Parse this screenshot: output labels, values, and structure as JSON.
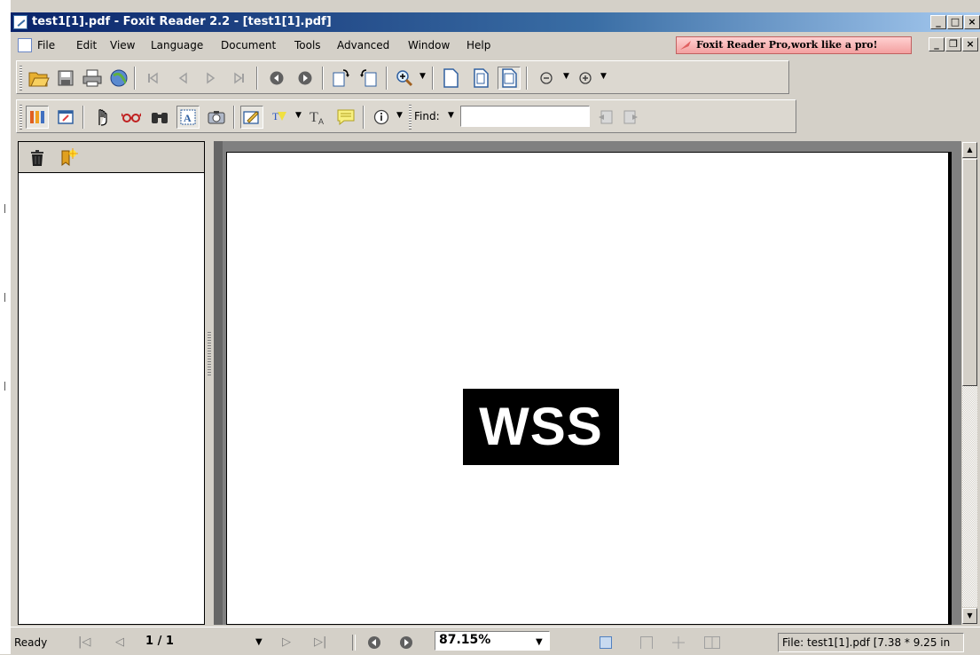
{
  "window": {
    "title": "test1[1].pdf - Foxit Reader 2.2 - [test1[1].pdf]",
    "controls": {
      "minimize": "_",
      "maximize": "□",
      "close": "×"
    }
  },
  "menu": {
    "items": [
      "File",
      "Edit",
      "View",
      "Language",
      "Document",
      "Tools",
      "Advanced",
      "Window",
      "Help"
    ],
    "ad_text": "Foxit Reader Pro,work like a pro!",
    "mdi_controls": {
      "minimize": "_",
      "restore": "❐",
      "close": "×"
    }
  },
  "toolbar1": {
    "icons": [
      "open-icon",
      "save-icon",
      "print-icon",
      "email-icon",
      "first-page-icon",
      "previous-page-icon",
      "next-page-icon",
      "last-page-icon",
      "go-back-icon",
      "go-forward-icon",
      "rotate-clockwise-icon",
      "rotate-counterclockwise-icon",
      "zoom-in-tool-icon",
      "actual-size-icon",
      "fit-page-icon",
      "fit-width-icon",
      "zoom-out-icon",
      "zoom-in-icon"
    ]
  },
  "toolbar2": {
    "icons": [
      "bookmarks-panel-icon",
      "fullscreen-icon",
      "hand-tool-icon",
      "reading-glasses-icon",
      "find-binoculars-icon",
      "select-text-icon",
      "snapshot-icon",
      "typewriter-icon",
      "highlight-icon",
      "text-tool-icon",
      "note-icon",
      "info-icon"
    ],
    "find_label": "Find:",
    "find_value": ""
  },
  "panel": {
    "icons": [
      "delete-bookmark-icon",
      "new-bookmark-icon"
    ]
  },
  "document": {
    "text": "WSS"
  },
  "status": {
    "ready": "Ready",
    "page": "1 / 1",
    "zoom": "87.15%",
    "file_info": "File: test1[1].pdf [7.38 * 9.25 in"
  },
  "colors": {
    "titlebar_start": "#0a246a",
    "titlebar_end": "#a6caf0",
    "chrome": "#d4d0c8",
    "ad_background": "#f3a0a0",
    "page_background": "#ffffff",
    "viewer_background": "#808080"
  }
}
